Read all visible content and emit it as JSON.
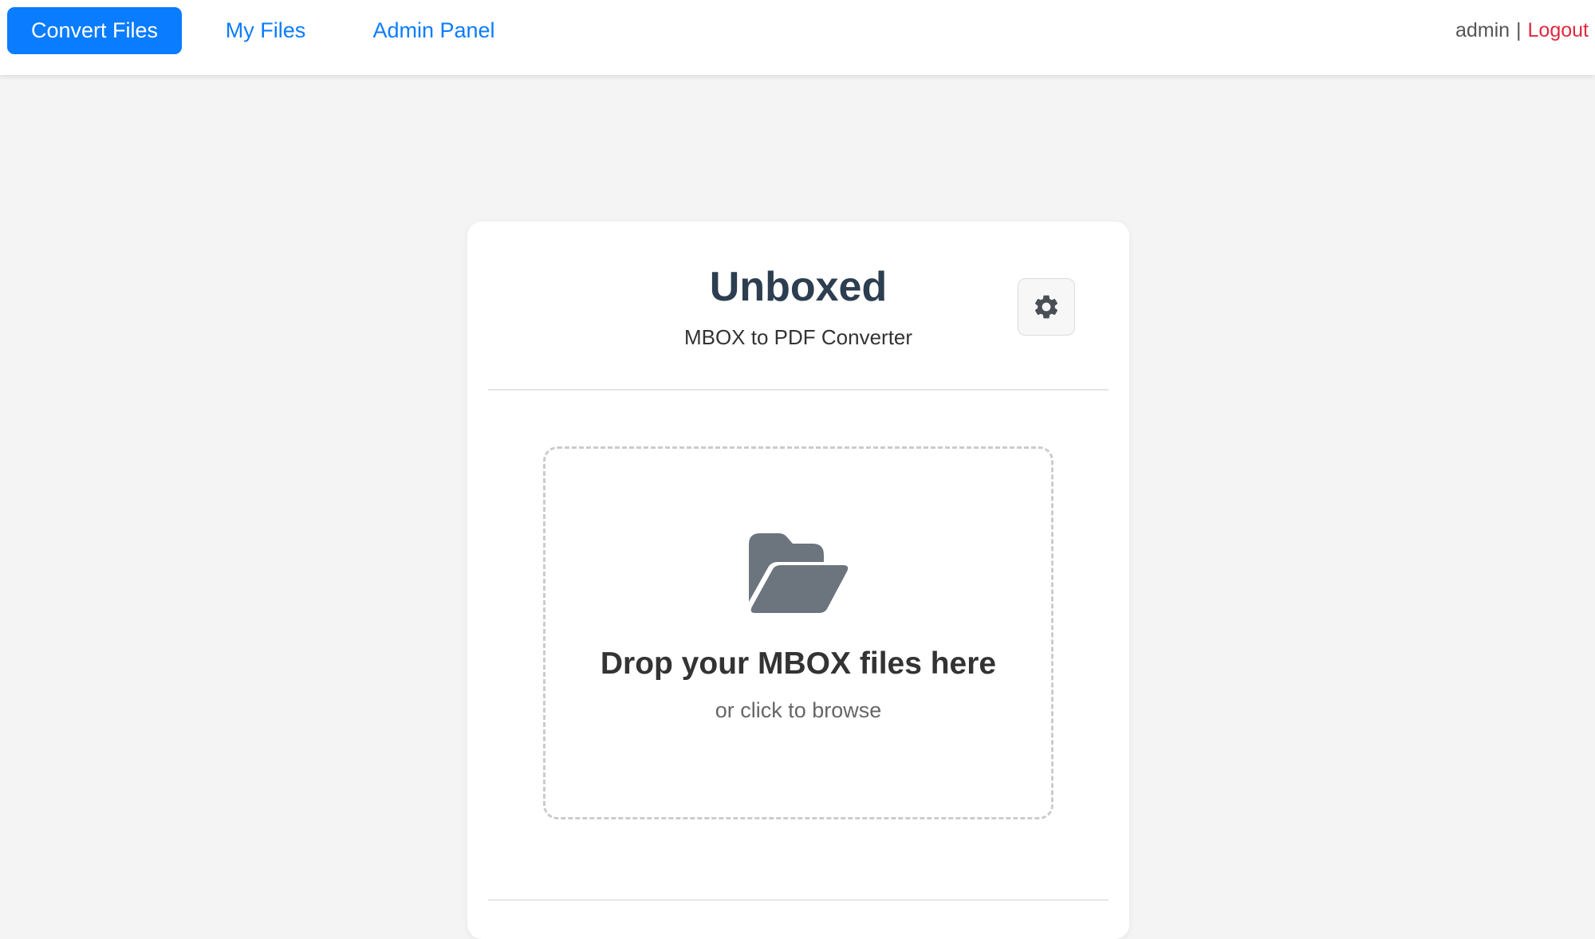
{
  "nav": {
    "items": [
      {
        "label": "Convert Files",
        "active": true
      },
      {
        "label": "My Files",
        "active": false
      },
      {
        "label": "Admin Panel",
        "active": false
      }
    ],
    "username": "admin",
    "separator": "|",
    "logout_label": "Logout"
  },
  "header": {
    "title": "Unboxed",
    "subtitle": "MBOX to PDF Converter",
    "settings_icon": "gear-icon"
  },
  "dropzone": {
    "icon": "folder-open-icon",
    "title": "Drop your MBOX files here",
    "subtitle": "or click to browse"
  },
  "colors": {
    "primary": "#0a7cff",
    "danger": "#e0283e",
    "title": "#2c3e50",
    "background": "#f4f4f4",
    "icon": "#6c757d"
  }
}
